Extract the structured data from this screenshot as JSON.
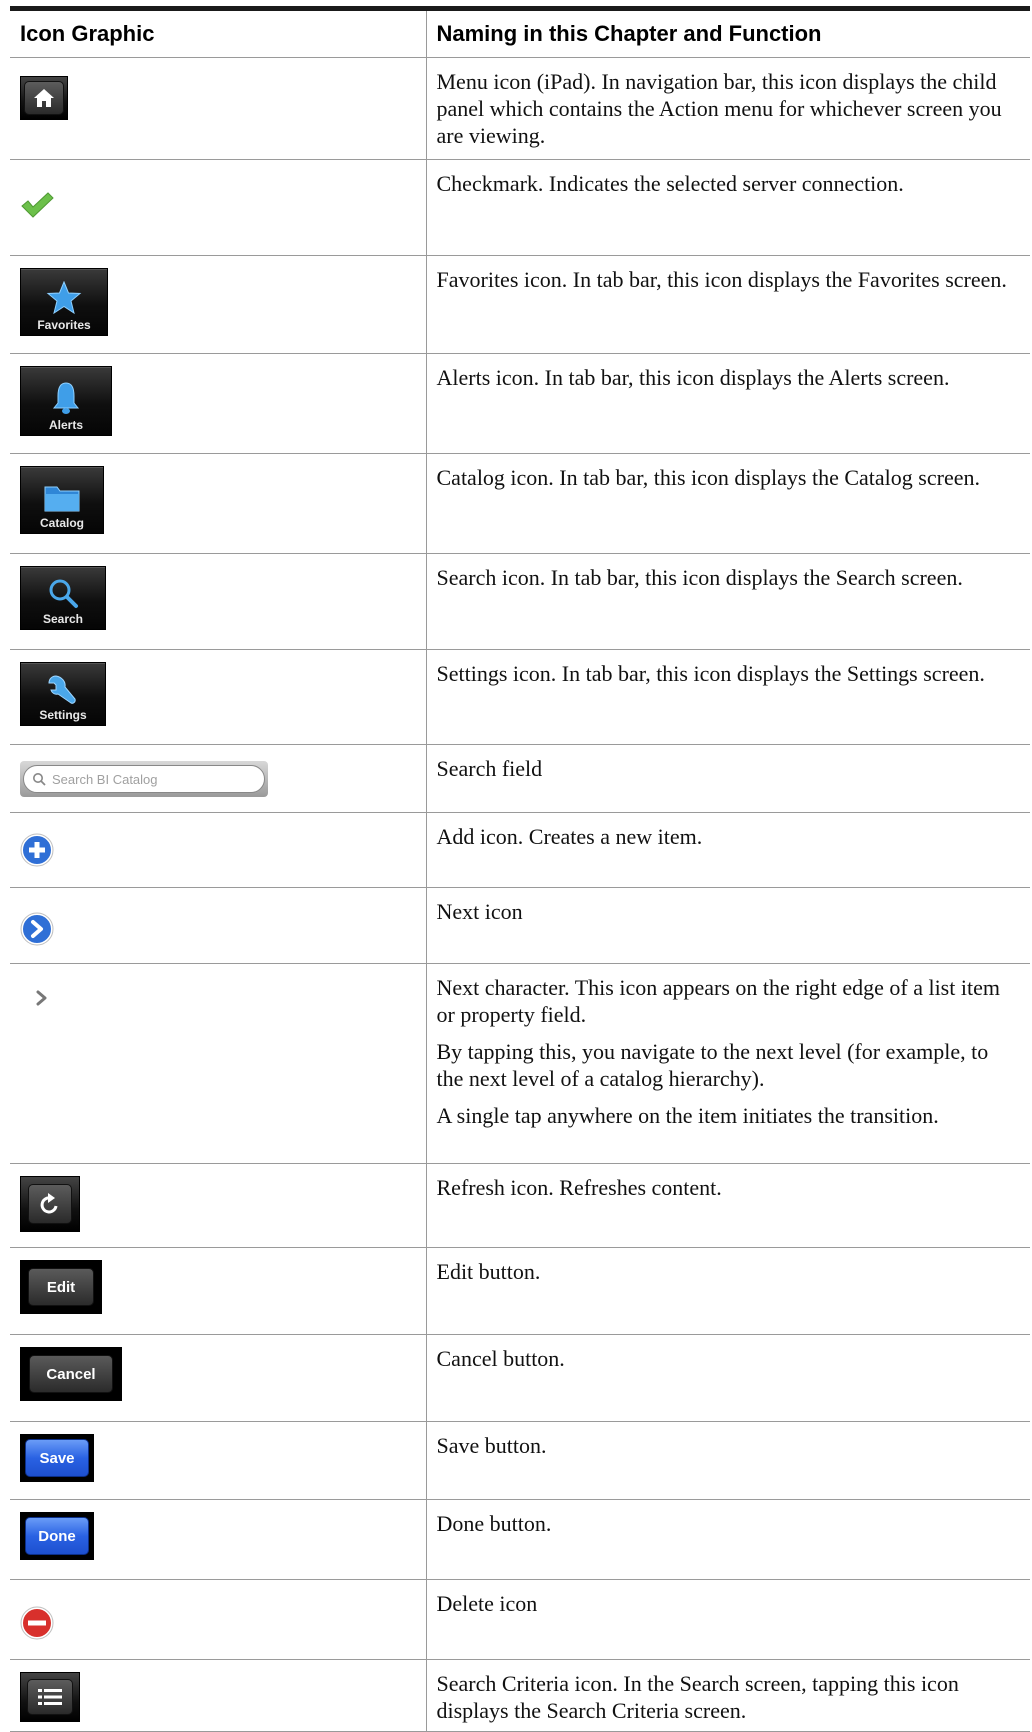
{
  "table": {
    "header": {
      "col1": "Icon Graphic",
      "col2": "Naming in this Chapter and Function"
    },
    "rows": [
      {
        "icon": "home-icon",
        "desc": [
          "Menu icon (iPad). In navigation bar, this icon displays the child panel which contains the Action menu for whichever screen you are viewing."
        ]
      },
      {
        "icon": "checkmark-icon",
        "desc": [
          "Checkmark. Indicates the selected server connection."
        ]
      },
      {
        "icon": "star-icon",
        "label": "Favorites",
        "desc": [
          "Favorites icon. In tab bar, this icon displays the Favorites screen."
        ]
      },
      {
        "icon": "bell-icon",
        "label": "Alerts",
        "desc": [
          "Alerts icon. In tab bar, this icon displays the Alerts screen."
        ]
      },
      {
        "icon": "folder-icon",
        "label": "Catalog",
        "desc": [
          "Catalog icon. In tab bar, this icon displays the Catalog screen."
        ]
      },
      {
        "icon": "magnifier-icon",
        "label": "Search",
        "desc": [
          "Search icon. In tab bar, this icon displays the Search screen."
        ]
      },
      {
        "icon": "wrench-icon",
        "label": "Settings",
        "desc": [
          "Settings icon. In tab bar, this icon displays the Settings screen."
        ]
      },
      {
        "icon": "search-field",
        "placeholder": "Search BI Catalog",
        "desc": [
          "Search field"
        ]
      },
      {
        "icon": "add-icon",
        "desc": [
          "Add icon. Creates a new item."
        ]
      },
      {
        "icon": "next-circle-icon",
        "desc": [
          "Next icon"
        ]
      },
      {
        "icon": "chevron-right-icon",
        "desc": [
          "Next character. This icon appears on the right edge of a list item or property field.",
          "By tapping this, you navigate to the next level (for example, to the next level of a catalog hierarchy).",
          "A single tap anywhere on the item initiates the transition."
        ]
      },
      {
        "icon": "refresh-icon",
        "desc": [
          "Refresh icon. Refreshes content."
        ]
      },
      {
        "icon": "edit-button",
        "label": "Edit",
        "desc": [
          "Edit button."
        ]
      },
      {
        "icon": "cancel-button",
        "label": "Cancel",
        "desc": [
          "Cancel button."
        ]
      },
      {
        "icon": "save-button",
        "label": "Save",
        "desc": [
          "Save button."
        ]
      },
      {
        "icon": "done-button",
        "label": "Done",
        "desc": [
          "Done button."
        ]
      },
      {
        "icon": "delete-icon",
        "desc": [
          "Delete icon"
        ]
      },
      {
        "icon": "list-icon",
        "desc": [
          "Search Criteria icon. In the Search screen, tapping this icon displays the Search Criteria screen."
        ]
      }
    ]
  },
  "colors": {
    "tab_bar": "#0f0f0f",
    "icon_blue": "#3f9ee8",
    "check_green": "#6cc04a",
    "button_blue": "#2a62e3",
    "delete_red": "#d8302c"
  }
}
